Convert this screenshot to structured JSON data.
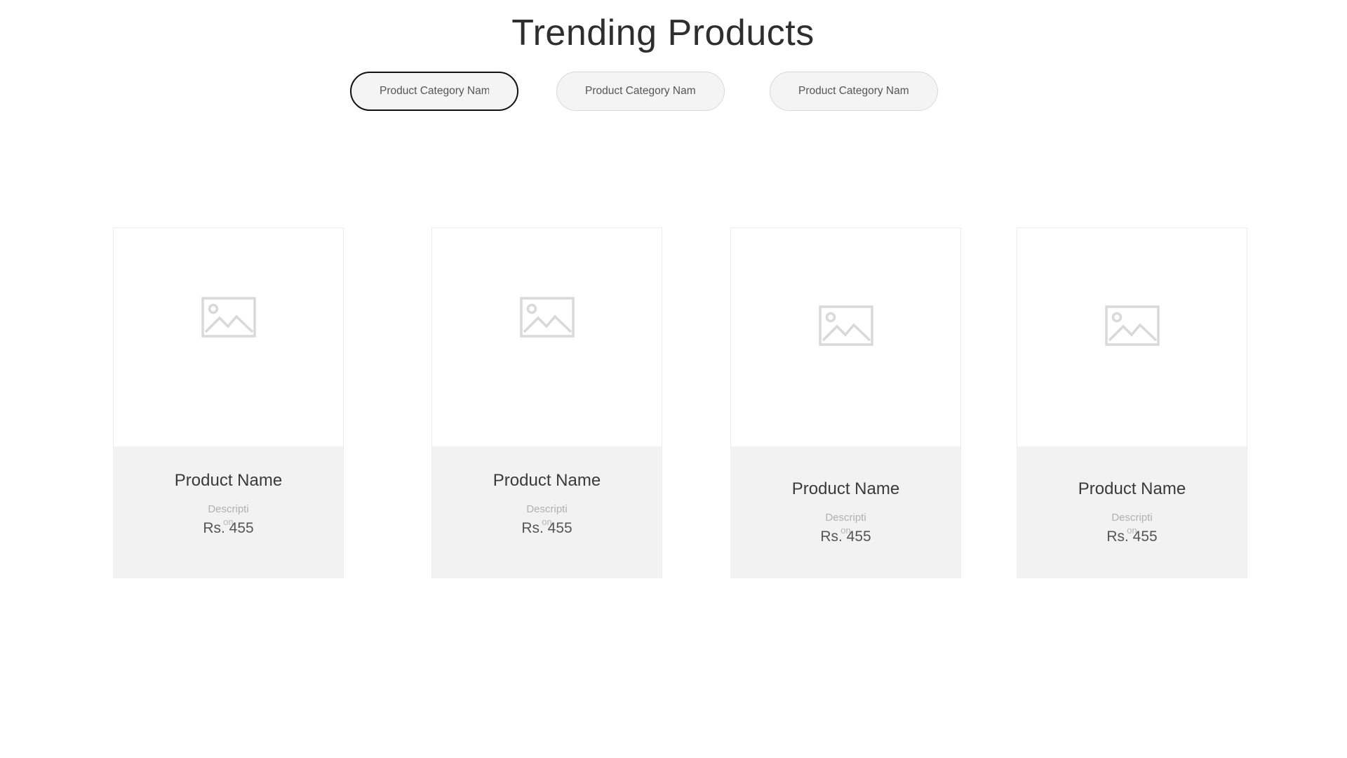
{
  "section": {
    "title": "Trending Products"
  },
  "tabs": [
    {
      "label": "Product Category Name",
      "active": true
    },
    {
      "label": "Product Category Name",
      "active": false
    },
    {
      "label": "Product Category Name",
      "active": false
    }
  ],
  "products": [
    {
      "name": "Product Name",
      "description_line1": "Descripti",
      "description_line2": "on",
      "price": "Rs. 455",
      "image_icon": "image-placeholder-icon"
    },
    {
      "name": "Product Name",
      "description_line1": "Descripti",
      "description_line2": "on",
      "price": "Rs. 455",
      "image_icon": "image-placeholder-icon"
    },
    {
      "name": "Product Name",
      "description_line1": "Descripti",
      "description_line2": "on",
      "price": "Rs. 455",
      "image_icon": "image-placeholder-icon"
    },
    {
      "name": "Product Name",
      "description_line1": "Descripti",
      "description_line2": "on",
      "price": "Rs. 455",
      "image_icon": "image-placeholder-icon"
    }
  ],
  "colors": {
    "info_background": "#f2f2f2",
    "tab_background": "#f4f4f4",
    "active_tab_border": "#111111",
    "placeholder_icon": "#d9d9d9"
  }
}
